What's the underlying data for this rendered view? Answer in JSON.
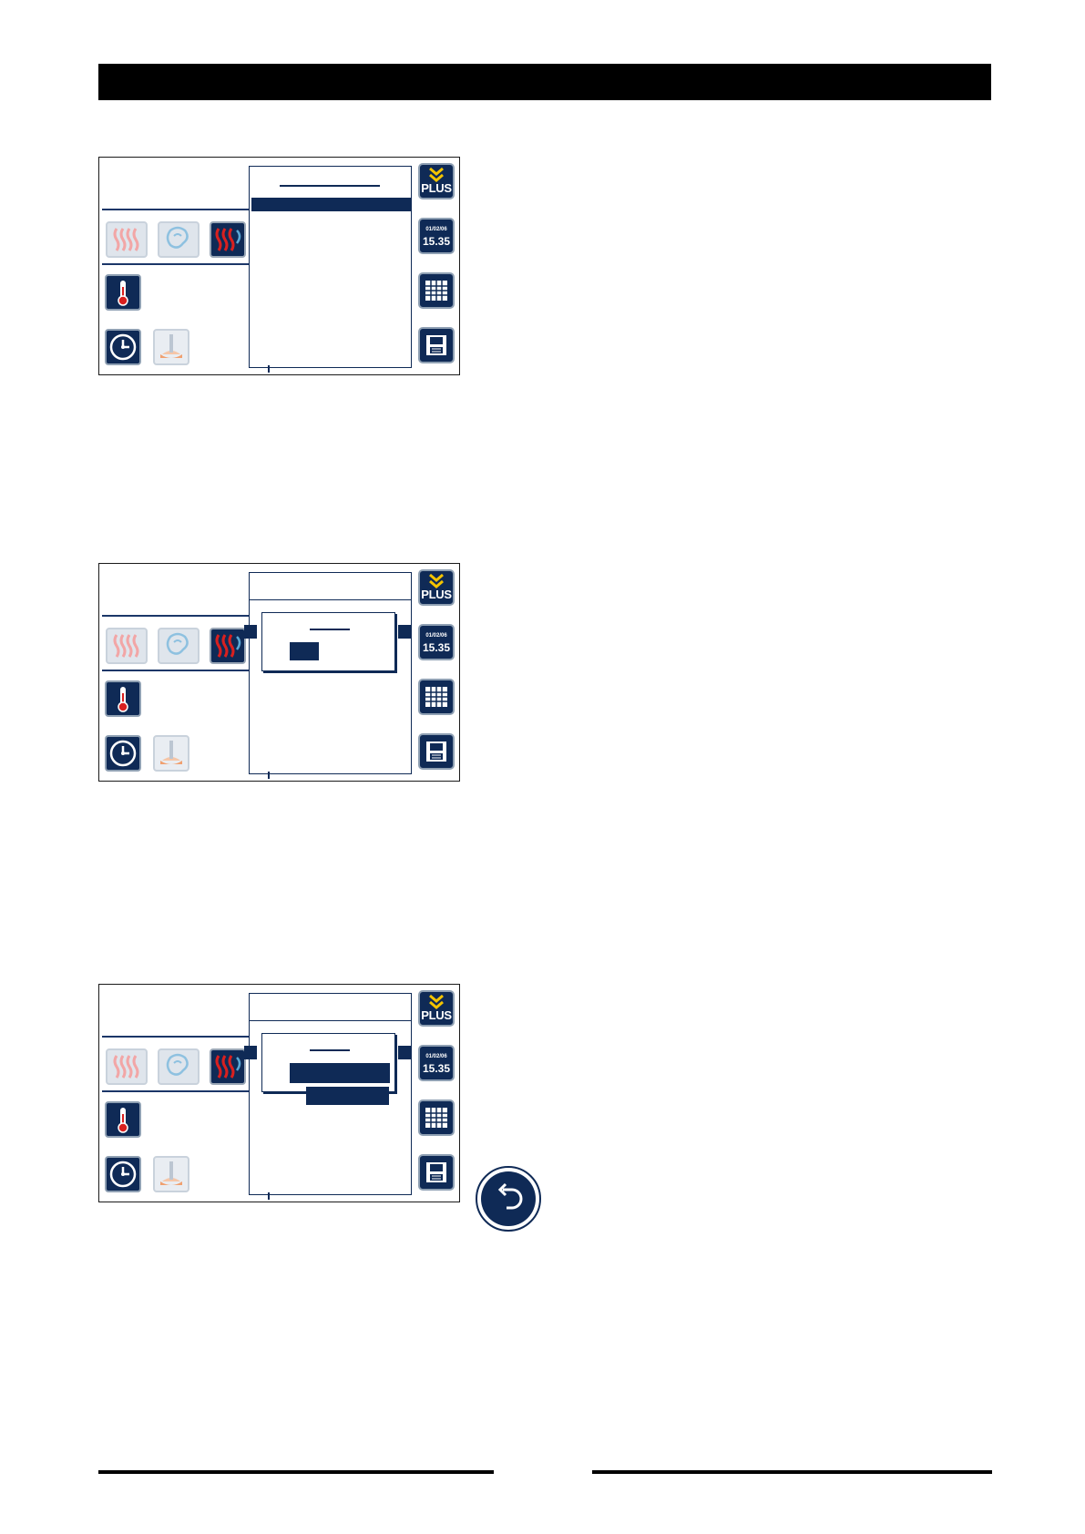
{
  "page": {
    "header_bar": "",
    "footer_left": "",
    "footer_right": ""
  },
  "screens": [
    {
      "id": "screen-1",
      "side_buttons": {
        "plus": "PLUS",
        "date": "01/02/06",
        "time": "15.35",
        "calendar_icon": "calendar-grid-icon",
        "save_icon": "floppy-disk-icon"
      },
      "mode_icons": [
        "convection-heat-icon",
        "steam-icon",
        "combi-heat-steam-icon"
      ],
      "controls": [
        "thermometer-icon",
        "clock-icon",
        "core-probe-icon"
      ]
    },
    {
      "id": "screen-2",
      "side_buttons": {
        "plus": "PLUS",
        "date": "01/02/06",
        "time": "15.35",
        "calendar_icon": "calendar-grid-icon",
        "save_icon": "floppy-disk-icon"
      },
      "mode_icons": [
        "convection-heat-icon",
        "steam-icon",
        "combi-heat-steam-icon"
      ],
      "controls": [
        "thermometer-icon",
        "clock-icon",
        "core-probe-icon"
      ]
    },
    {
      "id": "screen-3",
      "side_buttons": {
        "plus": "PLUS",
        "date": "01/02/06",
        "time": "15.35",
        "calendar_icon": "calendar-grid-icon",
        "save_icon": "floppy-disk-icon"
      },
      "mode_icons": [
        "convection-heat-icon",
        "steam-icon",
        "combi-heat-steam-icon"
      ],
      "controls": [
        "thermometer-icon",
        "clock-icon",
        "core-probe-icon"
      ]
    }
  ],
  "back_button": {
    "icon": "back-arrow-icon"
  },
  "colors": {
    "navy": "#0f2a56",
    "heat_red": "#d9201f",
    "steam_blue": "#5aa9d6",
    "probe_orange": "#f0a070"
  }
}
